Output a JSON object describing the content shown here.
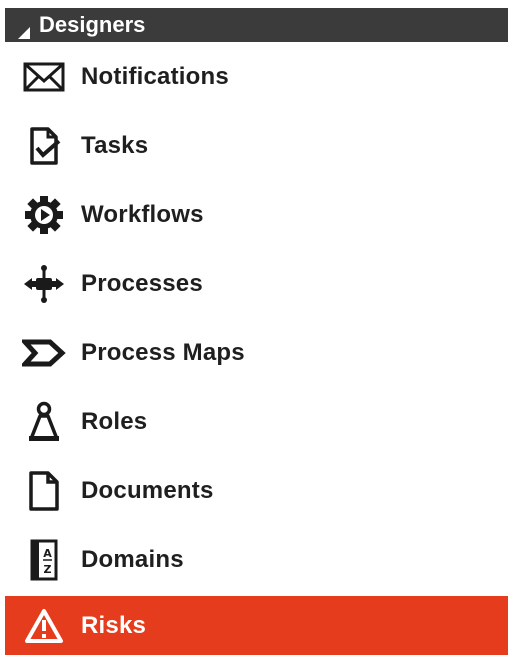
{
  "section": {
    "title": "Designers",
    "caret_icon": "triangle-down-icon"
  },
  "nav": {
    "items": [
      {
        "label": "Notifications",
        "icon": "envelope-icon"
      },
      {
        "label": "Tasks",
        "icon": "task-document-icon"
      },
      {
        "label": "Workflows",
        "icon": "gear-play-icon"
      },
      {
        "label": "Processes",
        "icon": "process-flow-icon"
      },
      {
        "label": "Process Maps",
        "icon": "process-map-chevron-icon"
      },
      {
        "label": "Roles",
        "icon": "person-icon"
      },
      {
        "label": "Documents",
        "icon": "document-icon"
      },
      {
        "label": "Domains",
        "icon": "domains-az-icon"
      },
      {
        "label": "Risks",
        "icon": "warning-triangle-icon",
        "active": true
      }
    ]
  },
  "colors": {
    "header_bg": "#3b3b3b",
    "active_bg": "#e43c1c",
    "text": "#1f1f1f"
  }
}
